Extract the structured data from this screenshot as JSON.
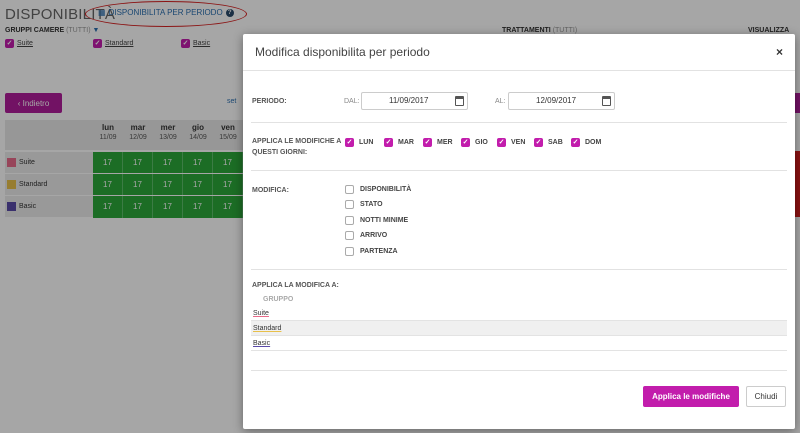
{
  "page": {
    "title": "DISPONIBILITÀ",
    "period_link": "DISPONIBILITA PER PERIODO",
    "help_glyph": "?",
    "gruppi_label": "GRUPPI CAMERE",
    "gruppi_tutti": "(TUTTI)",
    "filter_glyph": "▼",
    "trattamenti_label": "TRATTAMENTI",
    "trattamenti_tutti": "(TUTTI)",
    "visualizza_label": "VISUALIZZA",
    "back_button": "‹ Indietro",
    "set_link": "set",
    "check_glyph": "✓",
    "groups": [
      {
        "name": "Suite",
        "color": "#e86b8a"
      },
      {
        "name": "Standard",
        "color": "#e8c04a"
      },
      {
        "name": "Basic",
        "color": "#5a4aa8"
      }
    ],
    "days": [
      {
        "name": "lun",
        "date": "11/09"
      },
      {
        "name": "mar",
        "date": "12/09"
      },
      {
        "name": "mer",
        "date": "13/09"
      },
      {
        "name": "gio",
        "date": "14/09"
      },
      {
        "name": "ven",
        "date": "15/09"
      }
    ],
    "cell_value": "17"
  },
  "modal": {
    "title": "Modifica disponibilita per periodo",
    "close_glyph": "×",
    "periodo_label": "PERIODO:",
    "dal_label": "DAL:",
    "dal_value": "11/09/2017",
    "al_label": "AL:",
    "al_value": "12/09/2017",
    "applica_giorni_label": "APPLICA LE MODIFICHE A QUESTI GIORNI:",
    "weekdays": [
      "LUN",
      "MAR",
      "MER",
      "GIO",
      "VEN",
      "SAB",
      "DOM"
    ],
    "modifica_label": "MODIFICA:",
    "modifica_options": [
      "DISPONIBILITÀ",
      "STATO",
      "NOTTI MINIME",
      "ARRIVO",
      "PARTENZA"
    ],
    "applica_a_label": "APPLICA LA MODIFICA A:",
    "gruppo_header": "GRUPPO",
    "gruppo_rows": [
      "Suite",
      "Standard",
      "Basic"
    ],
    "apply_button": "Applica le modifiche",
    "close_button": "Chiudi"
  },
  "colors": {
    "accent": "#c21dac",
    "available_green": "#2ba83a",
    "link_blue": "#2a6fb0",
    "annotation_red": "#d62020"
  }
}
